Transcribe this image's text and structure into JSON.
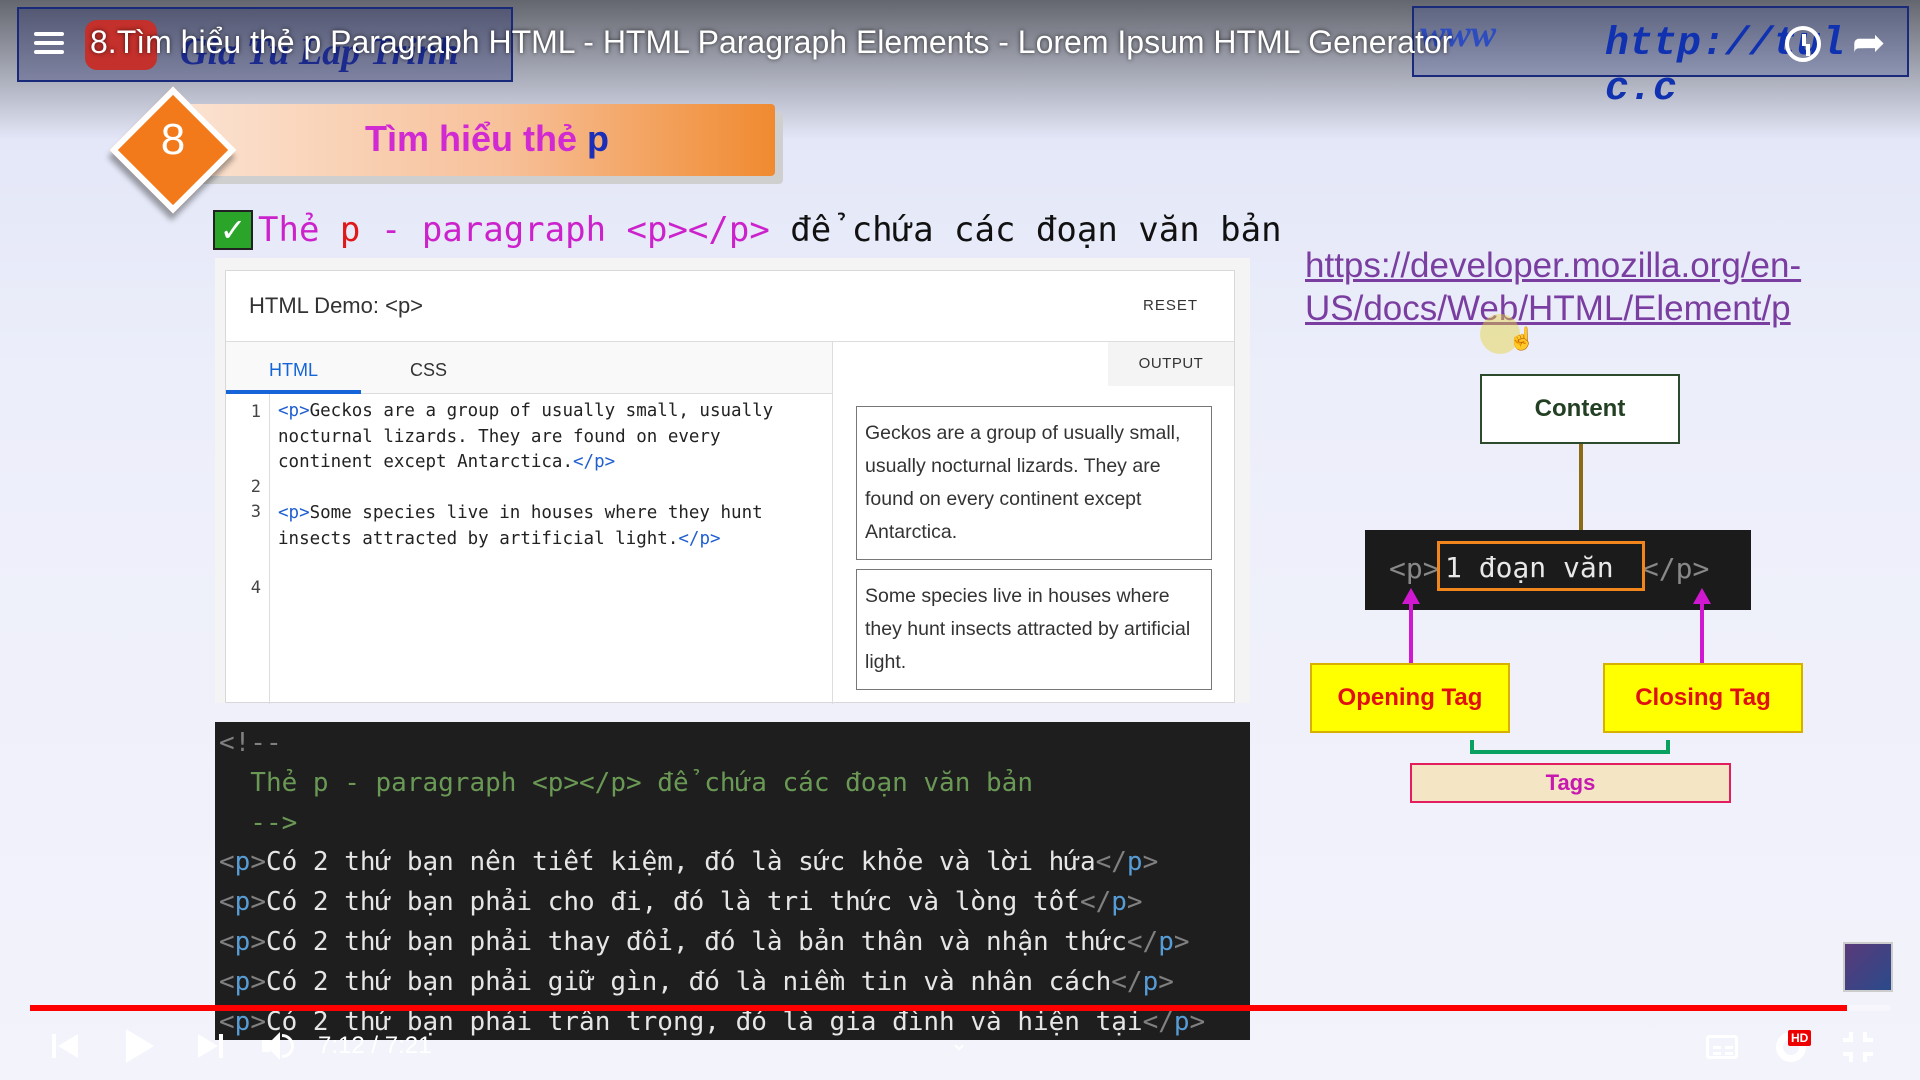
{
  "player": {
    "title": "8.Tìm hiểu thẻ p Paragraph HTML - HTML Paragraph Elements - Lorem Ipsum HTML Generator",
    "time_display": "7:12 / 7:21",
    "progress_fraction": 0.9769,
    "hd_badge": "HD"
  },
  "overlay": {
    "logo_text": "Gia Tu Lap Trinh",
    "www_text": "www",
    "url_text": "http://tul  c.c"
  },
  "slide": {
    "section_number": "8",
    "section_title_a": "Tìm hiểu thẻ",
    "section_title_b": "p",
    "intro_a": "Thẻ",
    "intro_b": "p",
    "intro_c": "- paragraph <p></p>",
    "intro_d": "để chứa các đoạn văn bản"
  },
  "demo": {
    "title": "HTML Demo: <p>",
    "reset": "RESET",
    "tabs": [
      "HTML",
      "CSS"
    ],
    "output_tab": "OUTPUT",
    "line_numbers": [
      "1",
      "2",
      "3",
      "4"
    ],
    "code_lines": [
      {
        "open": "<p>",
        "text": "Geckos are a group of usually small, usually",
        "close": ""
      },
      {
        "open": "",
        "text": "nocturnal lizards. They are found on every",
        "close": ""
      },
      {
        "open": "",
        "text": "continent except Antarctica.",
        "close": "</p>"
      },
      {
        "open": "<p>",
        "text": "Some species live in houses where they hunt",
        "close": ""
      },
      {
        "open": "",
        "text": "insects attracted by artificial light.",
        "close": "</p>"
      }
    ],
    "output_1": "Geckos are a group of usually small, usually nocturnal lizards. They are found on every continent except Antarctica.",
    "output_2": "Some species live in houses where they hunt insects attracted by artificial light."
  },
  "editor": {
    "comment_open": "<!--",
    "comment_body": "  Thẻ p - paragraph <p></p> để chứa các đoạn văn bản",
    "comment_close": "  -->",
    "lines": [
      "Có 2 thứ bạn nên tiết kiệm, đó là sức khỏe và lời hứa",
      "Có 2 thứ bạn phải cho đi, đó là tri thức và lòng tốt",
      "Có 2 thứ bạn phải thay đổi, đó là bản thân và nhận thức",
      "Có 2 thứ bạn phải giữ gìn, đó là niềm tin và nhân cách",
      "Có 2 thứ bạn phải trân trọng, đó là gia đình và hiện tại"
    ],
    "tag_open": "<p>",
    "tag_close": "</p>"
  },
  "diagram": {
    "mdn_link_1": "https://developer.mozilla.org/en-",
    "mdn_link_2": "US/docs/Web/HTML/Element/p",
    "content_label": "Content",
    "code_open": "<p>",
    "code_inner": "1 đoạn văn",
    "code_close": "</p>",
    "opening_tag": "Opening Tag",
    "closing_tag": "Closing Tag",
    "tags_label": "Tags"
  },
  "colors": {
    "accent_orange": "#f27a1a",
    "magenta": "#d22ad2",
    "progress_red": "#ff0000",
    "code_tag_blue": "#569cd6"
  },
  "icons": [
    "menu-icon",
    "watch-later-icon",
    "share-icon",
    "check-icon",
    "prev-icon",
    "play-icon",
    "next-icon",
    "volume-icon",
    "chevron-down-icon",
    "subtitles-icon",
    "settings-gear-icon",
    "fullscreen-exit-icon"
  ]
}
